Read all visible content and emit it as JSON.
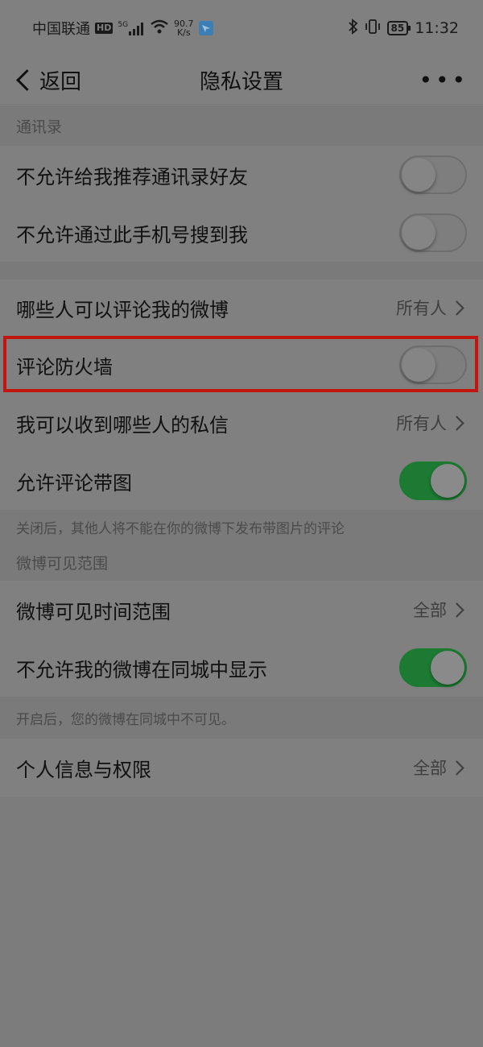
{
  "status_bar": {
    "carrier": "中国联通",
    "hd": "HD",
    "signal_type": "5G",
    "net_speed_value": "90.7",
    "net_speed_unit": "K/s",
    "battery": "85",
    "time": "11:32",
    "icons": [
      "signal-icon",
      "wifi-icon",
      "app-notification-icon",
      "bluetooth-icon",
      "vibrate-icon",
      "battery-icon"
    ]
  },
  "nav": {
    "back_label": "返回",
    "title": "隐私设置",
    "more_label": "•••"
  },
  "sections": {
    "contacts_header": "通讯录",
    "visibility_header": "微博可见范围"
  },
  "rows": {
    "no_recommend_contacts": {
      "label": "不允许给我推荐通讯录好友",
      "toggle": false
    },
    "no_search_by_phone": {
      "label": "不允许通过此手机号搜到我",
      "toggle": false
    },
    "who_can_comment": {
      "label": "哪些人可以评论我的微博",
      "value": "所有人"
    },
    "comment_firewall": {
      "label": "评论防火墙",
      "toggle": false
    },
    "who_can_message": {
      "label": "我可以收到哪些人的私信",
      "value": "所有人"
    },
    "allow_comment_images": {
      "label": "允许评论带图",
      "toggle": true
    },
    "visible_time_range": {
      "label": "微博可见时间范围",
      "value": "全部"
    },
    "hide_in_local": {
      "label": "不允许我的微博在同城中显示",
      "toggle": true
    },
    "personal_info": {
      "label": "个人信息与权限",
      "value": "全部"
    }
  },
  "notes": {
    "comment_images_note": "关闭后，其他人将不能在你的微博下发布带图片的评论",
    "local_note": "开启后，您的微博在同城中不可见。"
  },
  "colors": {
    "toggle_on": "#1d7a32",
    "highlight": "#c0160d"
  }
}
